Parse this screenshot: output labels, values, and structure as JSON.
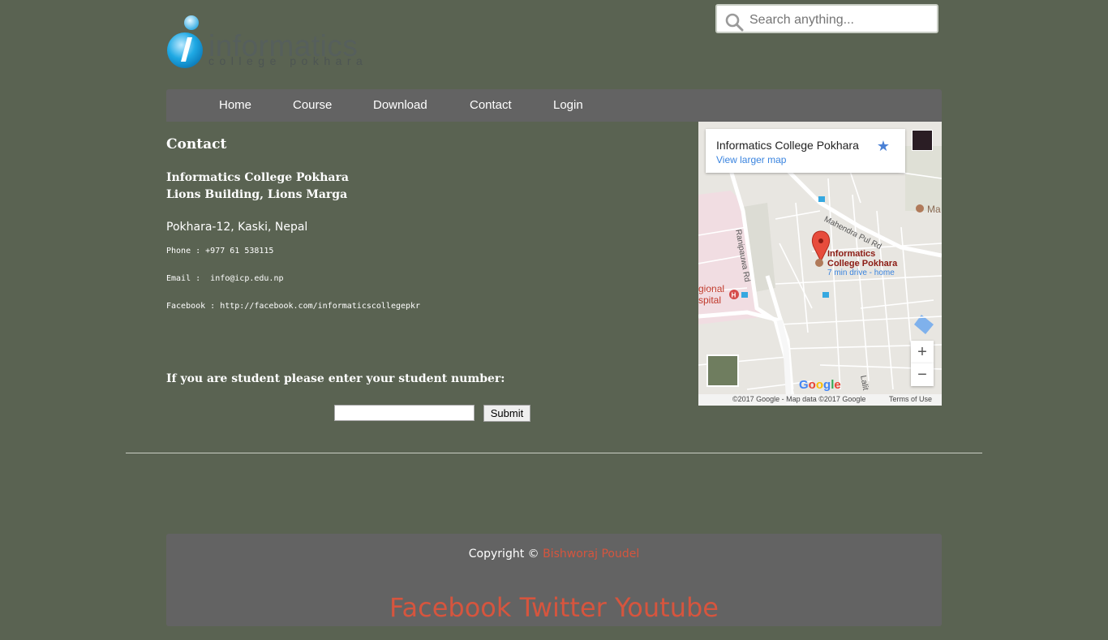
{
  "header": {
    "logo_word": "informatics",
    "logo_sub": "college pokhara",
    "search_placeholder": "Search anything..."
  },
  "nav": {
    "items": [
      {
        "label": "Home"
      },
      {
        "label": "Course"
      },
      {
        "label": "Download"
      },
      {
        "label": "Contact"
      },
      {
        "label": "Login"
      }
    ]
  },
  "contact": {
    "heading": "Contact",
    "address_line1": "Informatics College Pokhara",
    "address_line2": "Lions Building, Lions Marga",
    "address_line3": "Pokhara-12, Kaski, Nepal",
    "phone": "Phone : +977 61 538115",
    "email": "Email :  info@icp.edu.np",
    "facebook": "Facebook : http://facebook.com/informaticscollegepkr",
    "student_prompt": "If you are student please enter your student number:",
    "student_input_value": "",
    "submit_label": "Submit"
  },
  "map": {
    "place_title": "Informatics College Pokhara",
    "view_larger": "View larger map",
    "pin_label_line1": "Informatics",
    "pin_label_line2": "College Pokhara",
    "drive_info": "7 min drive - home",
    "road_mahendra": "Mahendra Pul Rd",
    "road_ranipauwa": "Ranipauwa Rd",
    "hospital_line1": "gional",
    "hospital_line2": "spital",
    "poi_ma": "Ma",
    "road_lalit": "Lalit",
    "zoom_in": "+",
    "zoom_out": "−",
    "google_logo": "Google",
    "copyright": "©2017 Google - Map data ©2017 Google",
    "terms": "Terms of Use"
  },
  "footer": {
    "copyright_prefix": "Copyright © ",
    "author": "Bishworaj Poudel",
    "social": [
      "Facebook",
      "Twitter",
      "Youtube"
    ]
  },
  "colors": {
    "page_bg": "#5a6352",
    "bar_bg": "#636363",
    "footer_link": "#d6553e",
    "map_link": "#3a84df",
    "pin_red": "#e74c3c"
  },
  "icons": {
    "search": "search-icon",
    "logo": "logo-i-icon",
    "star": "star-icon",
    "pin": "map-pin-icon",
    "hospital": "hospital-icon"
  }
}
